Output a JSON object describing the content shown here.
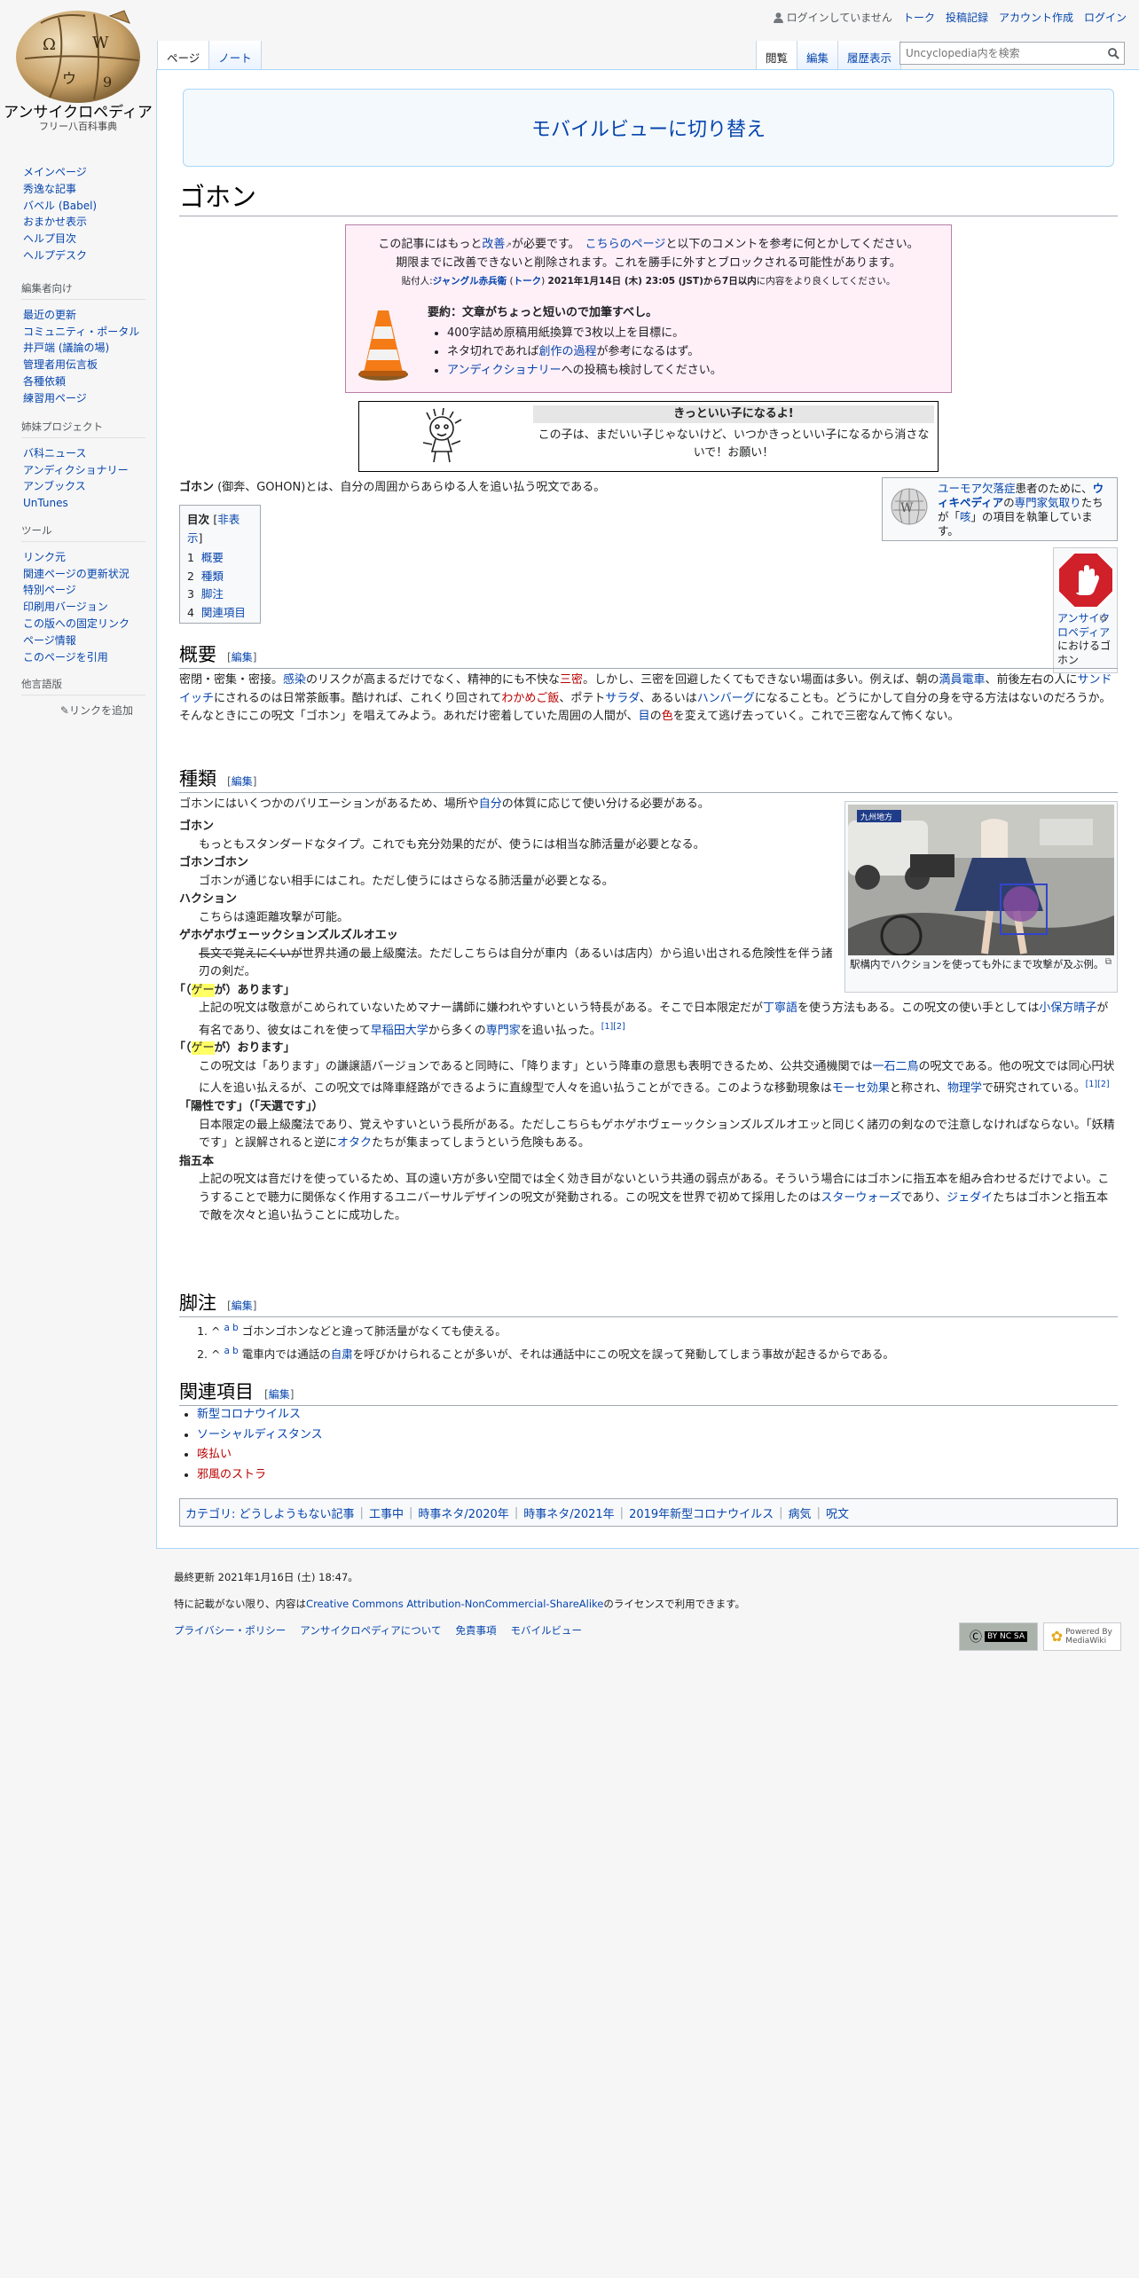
{
  "site": {
    "title": "アンサイクロペディア",
    "tagline": "フリー八百科事典"
  },
  "nav": {
    "main": [
      "メインページ",
      "秀逸な記事",
      "バベル (Babel)",
      "おまかせ表示",
      "ヘルプ目次",
      "ヘルプデスク"
    ],
    "editors": {
      "heading": "編集者向け",
      "items": [
        "最近の更新",
        "コミュニティ・ポータル",
        "井戸端 (議論の場)",
        "管理者用伝言板",
        "各種依頼",
        "練習用ページ"
      ]
    },
    "sister": {
      "heading": "姉妹プロジェクト",
      "items": [
        "バ科ニュース",
        "アンディクショナリー",
        "アンブックス",
        "UnTunes"
      ]
    },
    "tools": {
      "heading": "ツール",
      "items": [
        "リンク元",
        "関連ページの更新状況",
        "特別ページ",
        "印刷用バージョン",
        "この版への固定リンク",
        "ページ情報",
        "このページを引用"
      ]
    },
    "languages": {
      "heading": "他言語版",
      "add_link": "リンクを追加"
    }
  },
  "personal": {
    "status": "ログインしていません",
    "talk": "トーク",
    "contribs": "投稿記録",
    "create": "アカウント作成",
    "login": "ログイン"
  },
  "tabs": {
    "page": "ページ",
    "note": "ノート",
    "read": "閲覧",
    "edit": "編集",
    "history": "履歴表示"
  },
  "search": {
    "placeholder": "Uncyclopedia内を検索"
  },
  "mobile_switch": "モバイルビューに切り替え",
  "article": {
    "title": "ゴホン",
    "improve": {
      "l1a": "この記事にはもっと",
      "l1b": "改善",
      "l1c": "が必要です。",
      "l1d": "こちらのページ",
      "l1e": "と以下のコメントを参考に何とかしてください。",
      "line2": "期限までに改善できないと削除されます。これを勝手に外すとブロックされる可能性があります。",
      "l3a": "貼付人:",
      "l3user": "ジャングル赤兵衛",
      "l3talk": "トーク",
      "l3b": "2021年1月14日 (木) 23:05 (JST)から7日以内",
      "l3c": "に内容をより良くしてください。",
      "summary_title": "要約：文章がちょっと短いので加筆すべし。",
      "b1": "400字詰め原稿用紙換算で3枚以上を目標に。",
      "b2a": "ネタ切れであれば",
      "b2b": "創作の過程",
      "b2c": "が参考になるはず。",
      "b3a": "アンディクショナリー",
      "b3b": "への投稿も検討してください。"
    },
    "kitto": {
      "title": "きっといい子になるよ!",
      "text": "この子は、まだいい子じゃないけど、いつかきっといい子になるから消さないで！お願い！"
    },
    "uncy_box": {
      "a": "ユーモア欠落症",
      "b": "患者のために、",
      "c": "ウィキペディア",
      "d": "の",
      "e": "専門家気取り",
      "f": "たちが「",
      "g": "咳",
      "h": "」の項目を執筆しています。"
    },
    "stop_box": {
      "a": "アンサイクロペディア",
      "b": "におけるゴホン"
    },
    "intro": {
      "bold": "ゴホン",
      "rest": " (御奔、GOHON)とは、自分の周囲からあらゆる人を追い払う呪文である。"
    },
    "toc": {
      "title": "目次",
      "hide": "非表示",
      "items": [
        {
          "num": "1",
          "label": "概要"
        },
        {
          "num": "2",
          "label": "種類"
        },
        {
          "num": "3",
          "label": "脚注"
        },
        {
          "num": "4",
          "label": "関連項目"
        }
      ]
    },
    "edit_label": "編集",
    "overview": {
      "heading": "概要",
      "t1": "密閉・密集・密接。",
      "t2": "感染",
      "t3": "のリスクが高まるだけでなく、精神的にも不快な",
      "t4": "三密",
      "t5": "。しかし、三密を回避したくてもできない場面は多い。例えば、朝の",
      "t6": "満員電車",
      "t7": "、前後左右の人に",
      "t8": "サンドイッチ",
      "t9": "にされるのは日常茶飯事。酷ければ、これくり回されて",
      "t10": "わかめご飯",
      "t11": "、ポテト",
      "t12": "サラダ",
      "t13": "、あるいは",
      "t14": "ハンバーグ",
      "t15": "になることも。どうにかして自分の身を守る方法はないのだろうか。そんなときにこの呪文「ゴホン」を唱えてみよう。あれだけ密着していた周囲の人間が、",
      "t16": "目",
      "t17": "の",
      "t18": "色",
      "t19": "を変えて逃げ去っていく。これで三密なんて怖くない。"
    },
    "types": {
      "heading": "種類",
      "intro1": "ゴホンにはいくつかのバリエーションがあるため、場所や",
      "intro2": "自分",
      "intro3": "の体質に応じて使い分ける必要がある。",
      "thumb_caption": "駅構内でハクションを使っても外にまで攻撃が及ぶ例。",
      "thumb_sign": "九州地方",
      "d1_term": "ゴホン",
      "d1_def": "もっともスタンダードなタイプ。これでも充分効果的だが、使うには相当な肺活量が必要となる。",
      "d2_term": "ゴホンゴホン",
      "d2_def": "ゴホンが通じない相手にはこれ。ただし使うにはさらなる肺活量が必要となる。",
      "d3_term": "ハクション",
      "d3_def": "こちらは遠距離攻撃が可能。",
      "d4_term": "ゲホゲホヴェーックションズルズルオエッ",
      "d4_strike": "長文で覚えにくいが",
      "d4_def": "世界共通の最上級魔法。ただしこちらは自分が車内（あるいは店内）から追い出される危険性を伴う諸刃の剣だ。",
      "d5_q1": "「（",
      "d5_mark": "ゲー",
      "d5_q2": "が）あります」",
      "d5_a": "上記の呪文は敬意がこめられていないためマナー講師に嫌われやすいという特長がある。そこで日本限定だが",
      "d5_b": "丁寧語",
      "d5_c": "を使う方法もある。この呪文の使い手としては",
      "d5_d": "小保方晴子",
      "d5_e": "が有名であり、彼女はこれを使って",
      "d5_f": "早稲田大学",
      "d5_g": "から多くの",
      "d5_h": "専門家",
      "d5_i": "を追い払った。",
      "d6_q2": "が）おります」",
      "d6_a": "この呪文は「あります」の謙譲語バージョンであると同時に、「降ります」という降車の意思も表明できるため、公共交通機関では",
      "d6_b": "一石二鳥",
      "d6_c": "の呪文である。他の呪文では同心円状に人を追い払えるが、この呪文では降車経路ができるように直線型で人々を追い払うことができる。このような移動現象は",
      "d6_d": "モーセ効果",
      "d6_e": "と称され、",
      "d6_f": "物理学",
      "d6_g": "で研究されている。",
      "d7_term": "「陽性です」（「天選です」）",
      "d7_a": "日本限定の最上級魔法であり、覚えやすいという長所がある。ただしこちらもゲホゲホヴェーックションズルズルオエッと同じく諸刃の剣なので注意しなければならない。「妖精です」と誤解されると逆に",
      "d7_b": "オタク",
      "d7_c": "たちが集まってしまうという危険もある。",
      "d8_term": "指五本",
      "d8_a": "上記の呪文は音だけを使っているため、耳の遠い方が多い空間では全く効き目がないという共通の弱点がある。そういう場合にはゴホンに指五本を組み合わせるだけでよい。こうすることで聴力に関係なく作用するユニバーサルデザインの呪文が発動される。この呪文を世界で初めて採用したのは",
      "d8_b": "スターウォーズ",
      "d8_c": "であり、",
      "d8_d": "ジェダイ",
      "d8_e": "たちはゴホンと指五本で敵を次々と追い払うことに成功した。",
      "ref1": "[1]",
      "ref2": "[2]"
    },
    "notes": {
      "heading": "脚注",
      "caret": "^",
      "a": "a",
      "b": "b",
      "n1": "ゴホンゴホンなどと違って肺活量がなくても使える。",
      "n2a": "電車内では通話の",
      "n2b": "自粛",
      "n2c": "を呼びかけられることが多いが、それは通話中にこの呪文を誤って発動してしまう事故が起きるからである。"
    },
    "related": {
      "heading": "関連項目",
      "items": [
        "新型コロナウイルス",
        "ソーシャルディスタンス",
        "咳払い",
        "邪風のストラ"
      ]
    },
    "categories": {
      "label": "カテゴリ:",
      "items": [
        "どうしようもない記事",
        "工事中",
        "時事ネタ/2020年",
        "時事ネタ/2021年",
        "2019年新型コロナウイルス",
        "病気",
        "呪文"
      ]
    }
  },
  "footer": {
    "last_mod": "最終更新 2021年1月16日 (土) 18:47。",
    "license_a": "特に記載がない限り、内容は",
    "license_b": "Creative Commons Attribution-NonCommercial-ShareAlike",
    "license_c": "のライセンスで利用できます。",
    "links": [
      "プライバシー・ポリシー",
      "アンサイクロペディアについて",
      "免責事項",
      "モバイルビュー"
    ],
    "badge_cc": "BY NC SA",
    "badge_mw": "Powered By MediaWiki"
  },
  "colors": {
    "link": "#0645ad",
    "redlink": "#ba0000",
    "border": "#a7d7f9",
    "improve_bg": "#fff0f8",
    "improve_border": "#b67fa6"
  }
}
